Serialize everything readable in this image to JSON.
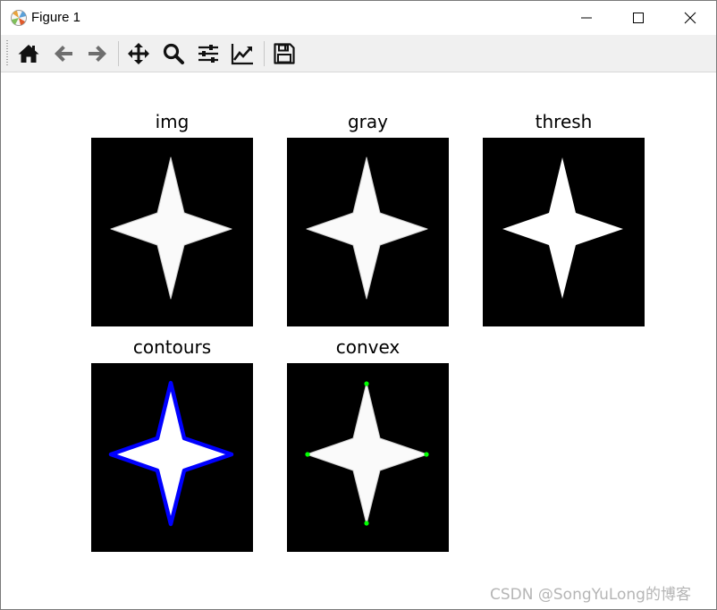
{
  "window": {
    "title": "Figure 1"
  },
  "toolbar": {
    "buttons": [
      {
        "name": "home",
        "icon": "home-icon"
      },
      {
        "name": "back",
        "icon": "arrow-left-icon"
      },
      {
        "name": "forward",
        "icon": "arrow-right-icon"
      },
      {
        "name": "pan",
        "icon": "move-icon"
      },
      {
        "name": "zoom",
        "icon": "magnifier-icon"
      },
      {
        "name": "configure-subplots",
        "icon": "sliders-icon"
      },
      {
        "name": "edit-axis",
        "icon": "line-chart-icon"
      },
      {
        "name": "save",
        "icon": "floppy-disk-icon"
      }
    ]
  },
  "figure": {
    "panels": [
      {
        "title": "img"
      },
      {
        "title": "gray"
      },
      {
        "title": "thresh"
      },
      {
        "title": "contours"
      },
      {
        "title": "convex"
      }
    ]
  },
  "colors": {
    "contour": "#0000ff",
    "hull_points": "#00ff00",
    "star_fill": "#ffffff",
    "image_bg": "#000000"
  },
  "watermark": {
    "text": "CSDN @SongYuLong的博客"
  }
}
